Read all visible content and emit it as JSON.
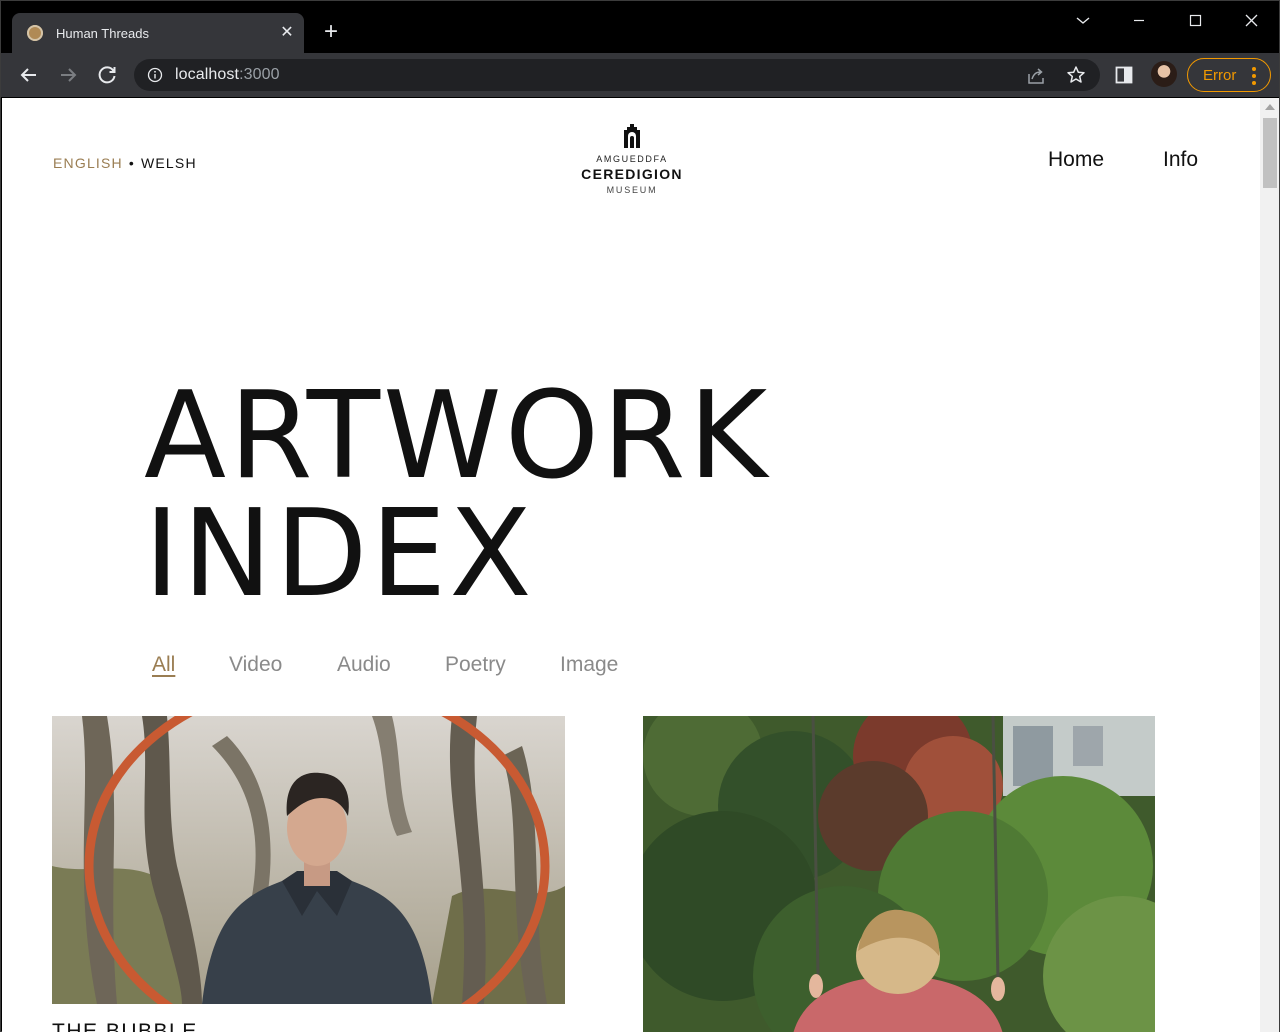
{
  "browser": {
    "tab_title": "Human Threads",
    "url_host": "localhost",
    "url_port": ":3000",
    "profile_status": "Error",
    "accent_error": "#f29900"
  },
  "site": {
    "language": {
      "english": "ENGLISH",
      "separator": "•",
      "welsh": "WELSH"
    },
    "logo": {
      "top": "AMGUEDDFA",
      "main": "CEREDIGION",
      "bottom": "MUSEUM"
    },
    "nav": {
      "home": "Home",
      "info": "Info"
    },
    "hero": {
      "line1": "ARTWORK",
      "line2": "INDEX"
    },
    "filters": [
      "All",
      "Video",
      "Audio",
      "Poetry",
      "Image"
    ],
    "active_filter": "All",
    "accent_color": "#9a7d52",
    "artworks": [
      {
        "title": "THE BUBBLE"
      }
    ]
  }
}
